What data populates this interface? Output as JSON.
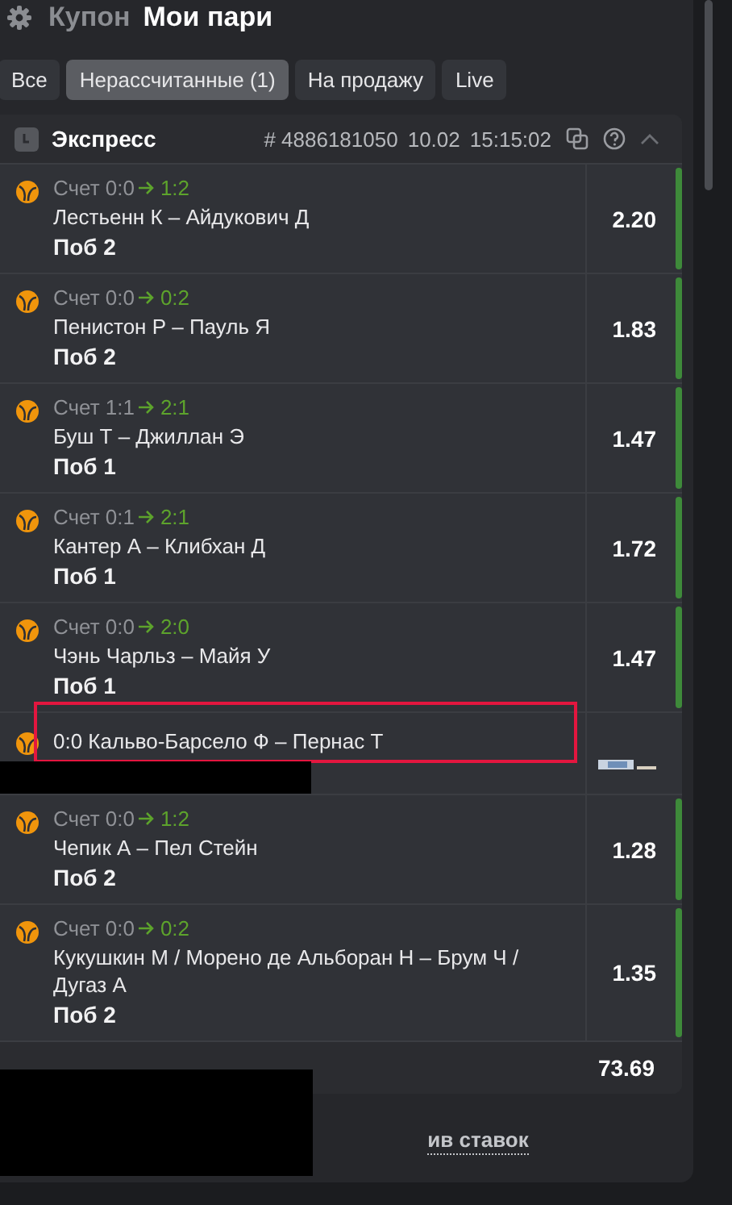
{
  "header": {
    "coupon_tab": "Купон",
    "bets_tab": "Мои пари"
  },
  "filters": [
    {
      "label": "Все",
      "selected": false
    },
    {
      "label": "Нерассчитанные (1)",
      "selected": true
    },
    {
      "label": "На продажу",
      "selected": false
    },
    {
      "label": "Live",
      "selected": false
    }
  ],
  "bet": {
    "type": "Экспресс",
    "number": "# 4886181050",
    "date": "10.02",
    "time": "15:15:02",
    "expanded": true,
    "selections": [
      {
        "kind": "scored",
        "score": "Счет 0:0",
        "new_score": "1:2",
        "event": "Лестьенн К – Айдукович Д",
        "pick": "Поб 2",
        "odds": "2.20",
        "won": true
      },
      {
        "kind": "scored",
        "score": "Счет 0:0",
        "new_score": "0:2",
        "event": "Пенистон Р – Пауль Я",
        "pick": "Поб 2",
        "odds": "1.83",
        "won": true
      },
      {
        "kind": "scored",
        "score": "Счет 1:1",
        "new_score": "2:1",
        "event": "Буш Т – Джиллан Э",
        "pick": "Поб 1",
        "odds": "1.47",
        "won": true
      },
      {
        "kind": "scored",
        "score": "Счет 0:1",
        "new_score": "2:1",
        "event": "Кантер А – Клибхан Д",
        "pick": "Поб 1",
        "odds": "1.72",
        "won": true
      },
      {
        "kind": "scored",
        "score": "Счет 0:0",
        "new_score": "2:0",
        "event": "Чэнь Чарльз – Майя У",
        "pick": "Поб 1",
        "odds": "1.47",
        "won": true
      },
      {
        "kind": "live",
        "event": "0:0 Кальво-Барсело Ф – Пернас Т",
        "won": false
      },
      {
        "kind": "scored",
        "score": "Счет 0:0",
        "new_score": "1:2",
        "event": "Чепик А – Пел Стейн",
        "pick": "Поб 2",
        "odds": "1.28",
        "won": true
      },
      {
        "kind": "scored",
        "score": "Счет 0:0",
        "new_score": "0:2",
        "event": "Кукушкин М / Морено де Альборан Н – Брум Ч / Дугаз А",
        "pick": "Поб 2",
        "odds": "1.35",
        "won": true
      }
    ],
    "total_odds": "73.69"
  },
  "archive_link": "ив ставок"
}
